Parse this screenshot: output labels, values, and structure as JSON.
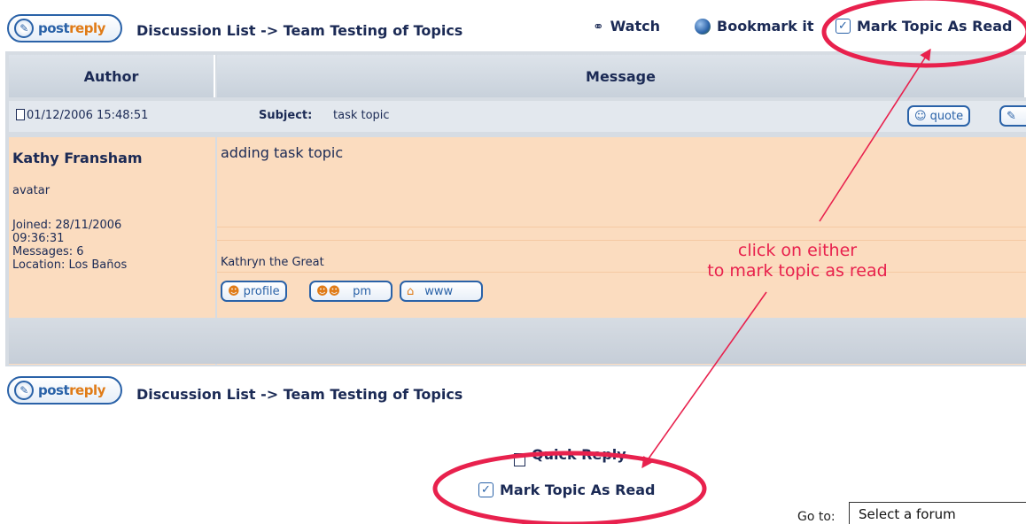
{
  "top_bar": {
    "postreply": {
      "word1": "post",
      "word2": "reply"
    },
    "breadcrumb": "Discussion List -> Team Testing of Topics",
    "watch": "Watch",
    "bookmark": "Bookmark it",
    "mark_read": "Mark Topic As Read"
  },
  "table": {
    "headers": {
      "author": "Author",
      "message": "Message"
    },
    "post": {
      "date": "01/12/2006 15:48:51",
      "subject_label": "Subject:",
      "subject": "task topic",
      "quote": "quote",
      "author_name": "Kathy Fransham",
      "avatar": "avatar",
      "joined": "Joined: 28/11/2006",
      "joined_time": "09:36:31",
      "messages": "Messages: 6",
      "location": "Location: Los Baños",
      "body": "adding task topic",
      "signature": "Kathryn the Great",
      "profile": "profile",
      "pm": "pm",
      "www": "www"
    }
  },
  "bottom_bar": {
    "postreply": {
      "word1": "post",
      "word2": "reply"
    },
    "breadcrumb": "Discussion List -> Team Testing of Topics"
  },
  "quick_reply": "Quick Reply",
  "mark_read_bottom": "Mark Topic As Read",
  "annotation": {
    "line1": "click on either",
    "line2": "to mark topic as read"
  },
  "goto": {
    "label": "Go to:",
    "selected": "Select a forum"
  },
  "colors": {
    "annotation": "#e8214d",
    "post_bg": "#fbdcbf",
    "link": "#1b2a55",
    "accent": "#2a62a8"
  }
}
